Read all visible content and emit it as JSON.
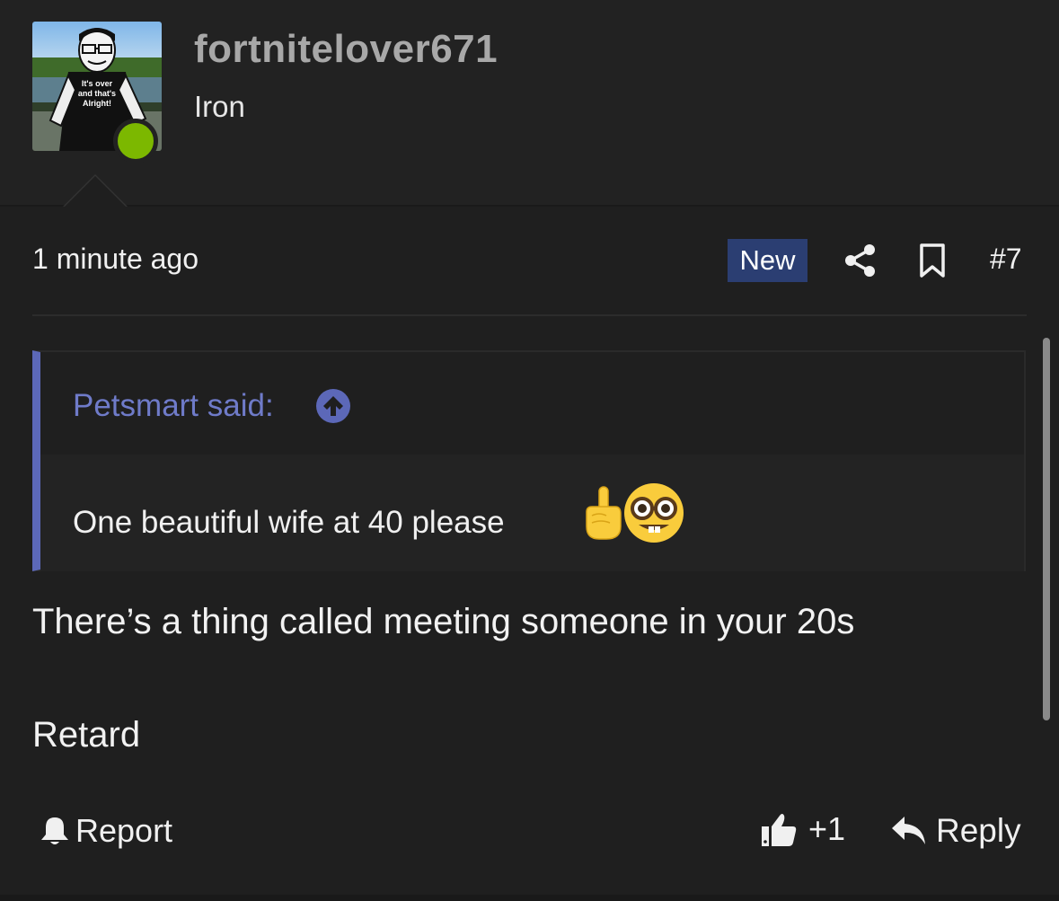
{
  "user": {
    "username": "fortnitelover671",
    "title": "Iron",
    "avatar_shirt_text": "It's over and that's Alright!",
    "online_color": "#7cb800"
  },
  "post": {
    "timestamp": "1 minute ago",
    "badge": "New",
    "number": "#7",
    "share_icon": "share-icon",
    "bookmark_icon": "bookmark-icon"
  },
  "quote": {
    "author": "Petsmart said:",
    "text": "One beautiful wife at 40 please",
    "emojis": [
      "pointing-up-finger",
      "nerd-face"
    ],
    "accent_color": "#5c68b8"
  },
  "message": {
    "line1": "There’s a thing called meeting someone in your 20s",
    "line2": "Retard"
  },
  "actions": {
    "report_label": "Report",
    "like_label": "+1",
    "reply_label": "Reply"
  },
  "colors": {
    "background": "#1f1f1f",
    "header": "#222222",
    "badge": "#2b3e72",
    "quote_link": "#6f7bc9"
  }
}
